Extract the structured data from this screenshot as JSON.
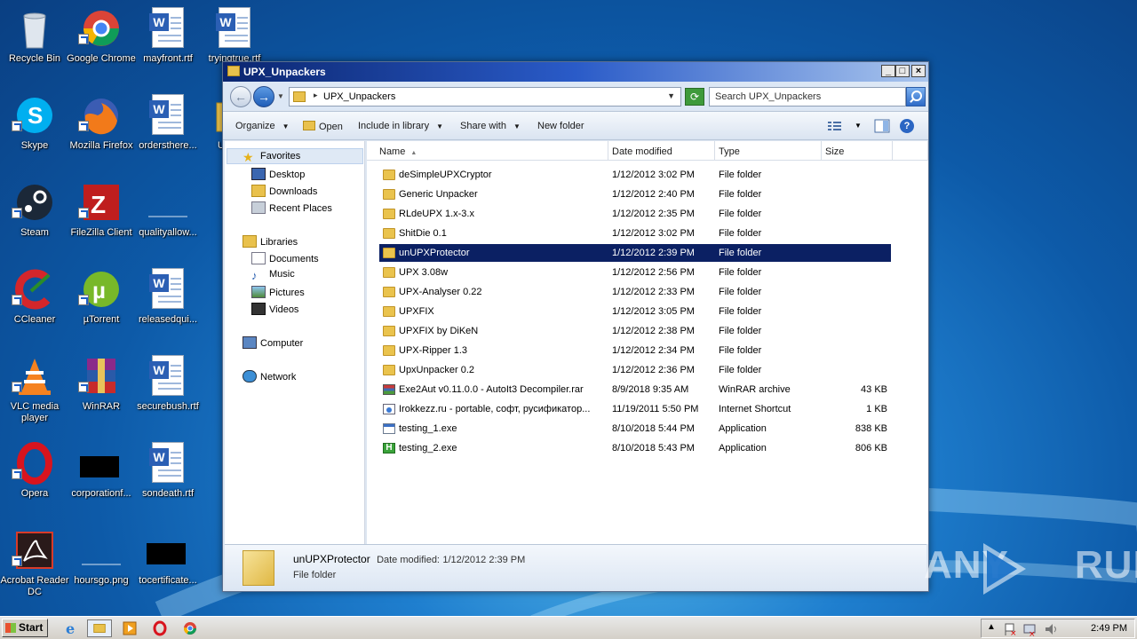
{
  "desktop": {
    "icons": [
      {
        "label": "Recycle Bin",
        "icon": "recycle-bin-icon"
      },
      {
        "label": "Google Chrome",
        "icon": "chrome-icon"
      },
      {
        "label": "mayfront.rtf",
        "icon": "word-document-icon"
      },
      {
        "label": "tryingtrue.rtf",
        "icon": "word-document-icon"
      },
      {
        "label": "Skype",
        "icon": "skype-icon"
      },
      {
        "label": "Mozilla Firefox",
        "icon": "firefox-icon"
      },
      {
        "label": "ordersthere...",
        "icon": "word-document-icon"
      },
      {
        "label": "UPX_...",
        "icon": "folder-icon"
      },
      {
        "label": "Steam",
        "icon": "steam-icon"
      },
      {
        "label": "FileZilla Client",
        "icon": "filezilla-icon"
      },
      {
        "label": "qualityallow...",
        "icon": "blank-file-icon"
      },
      {
        "label": "CCleaner",
        "icon": "ccleaner-icon"
      },
      {
        "label": "µTorrent",
        "icon": "utorrent-icon"
      },
      {
        "label": "releasedqui...",
        "icon": "word-document-icon"
      },
      {
        "label": "VLC media player",
        "icon": "vlc-icon"
      },
      {
        "label": "WinRAR",
        "icon": "winrar-icon"
      },
      {
        "label": "securebush.rtf",
        "icon": "word-document-icon"
      },
      {
        "label": "Opera",
        "icon": "opera-icon"
      },
      {
        "label": "corporationf...",
        "icon": "black-image-icon"
      },
      {
        "label": "sondeath.rtf",
        "icon": "word-document-icon"
      },
      {
        "label": "Acrobat Reader DC",
        "icon": "acrobat-icon"
      },
      {
        "label": "hoursgo.png",
        "icon": "image-file-icon"
      },
      {
        "label": "tocertificate...",
        "icon": "black-image-icon"
      }
    ]
  },
  "window": {
    "title": "UPX_Unpackers",
    "controls": {
      "minimize": "_",
      "maximize": "□",
      "close": "×"
    },
    "address": {
      "path": "UPX_Unpackers",
      "separator": "▸"
    },
    "search": {
      "placeholder": "Search UPX_Unpackers"
    },
    "toolbar": {
      "organize": "Organize",
      "open": "Open",
      "include_in_library": "Include in library",
      "share_with": "Share with",
      "new_folder": "New folder"
    },
    "nav": {
      "favorites": "Favorites",
      "desktop": "Desktop",
      "downloads": "Downloads",
      "recent_places": "Recent Places",
      "libraries": "Libraries",
      "documents": "Documents",
      "music": "Music",
      "pictures": "Pictures",
      "videos": "Videos",
      "computer": "Computer",
      "network": "Network"
    },
    "columns": {
      "name": "Name",
      "date": "Date modified",
      "type": "Type",
      "size": "Size"
    },
    "files": [
      {
        "name": "deSimpleUPXCryptor",
        "date": "1/12/2012 3:02 PM",
        "type": "File folder",
        "size": "",
        "icon": "folder"
      },
      {
        "name": "Generic Unpacker",
        "date": "1/12/2012 2:40 PM",
        "type": "File folder",
        "size": "",
        "icon": "folder"
      },
      {
        "name": "RLdeUPX 1.x-3.x",
        "date": "1/12/2012 2:35 PM",
        "type": "File folder",
        "size": "",
        "icon": "folder"
      },
      {
        "name": "ShitDie 0.1",
        "date": "1/12/2012 3:02 PM",
        "type": "File folder",
        "size": "",
        "icon": "folder"
      },
      {
        "name": "unUPXProtector",
        "date": "1/12/2012 2:39 PM",
        "type": "File folder",
        "size": "",
        "icon": "folder",
        "selected": true
      },
      {
        "name": "UPX 3.08w",
        "date": "1/12/2012 2:56 PM",
        "type": "File folder",
        "size": "",
        "icon": "folder"
      },
      {
        "name": "UPX-Analyser 0.22",
        "date": "1/12/2012 2:33 PM",
        "type": "File folder",
        "size": "",
        "icon": "folder"
      },
      {
        "name": "UPXFIX",
        "date": "1/12/2012 3:05 PM",
        "type": "File folder",
        "size": "",
        "icon": "folder"
      },
      {
        "name": "UPXFIX by DiKeN",
        "date": "1/12/2012 2:38 PM",
        "type": "File folder",
        "size": "",
        "icon": "folder"
      },
      {
        "name": "UPX-Ripper 1.3",
        "date": "1/12/2012 2:34 PM",
        "type": "File folder",
        "size": "",
        "icon": "folder"
      },
      {
        "name": "UpxUnpacker 0.2",
        "date": "1/12/2012 2:36 PM",
        "type": "File folder",
        "size": "",
        "icon": "folder"
      },
      {
        "name": "Exe2Aut v0.11.0.0 - AutoIt3 Decompiler.rar",
        "date": "8/9/2018 9:35 AM",
        "type": "WinRAR archive",
        "size": "43 KB",
        "icon": "rar"
      },
      {
        "name": "Irokkezz.ru - portable, софт, русификатор...",
        "date": "11/19/2011 5:50 PM",
        "type": "Internet Shortcut",
        "size": "1 KB",
        "icon": "url"
      },
      {
        "name": "testing_1.exe",
        "date": "8/10/2018 5:44 PM",
        "type": "Application",
        "size": "838 KB",
        "icon": "exe1"
      },
      {
        "name": "testing_2.exe",
        "date": "8/10/2018 5:43 PM",
        "type": "Application",
        "size": "806 KB",
        "icon": "exe2"
      }
    ],
    "details": {
      "name": "unUPXProtector",
      "date_label": "Date modified:",
      "date": "1/12/2012 2:39 PM",
      "type": "File folder"
    }
  },
  "taskbar": {
    "start": "Start",
    "clock": "2:49 PM"
  },
  "watermark": {
    "left": "ANY",
    "right": "RUN"
  }
}
